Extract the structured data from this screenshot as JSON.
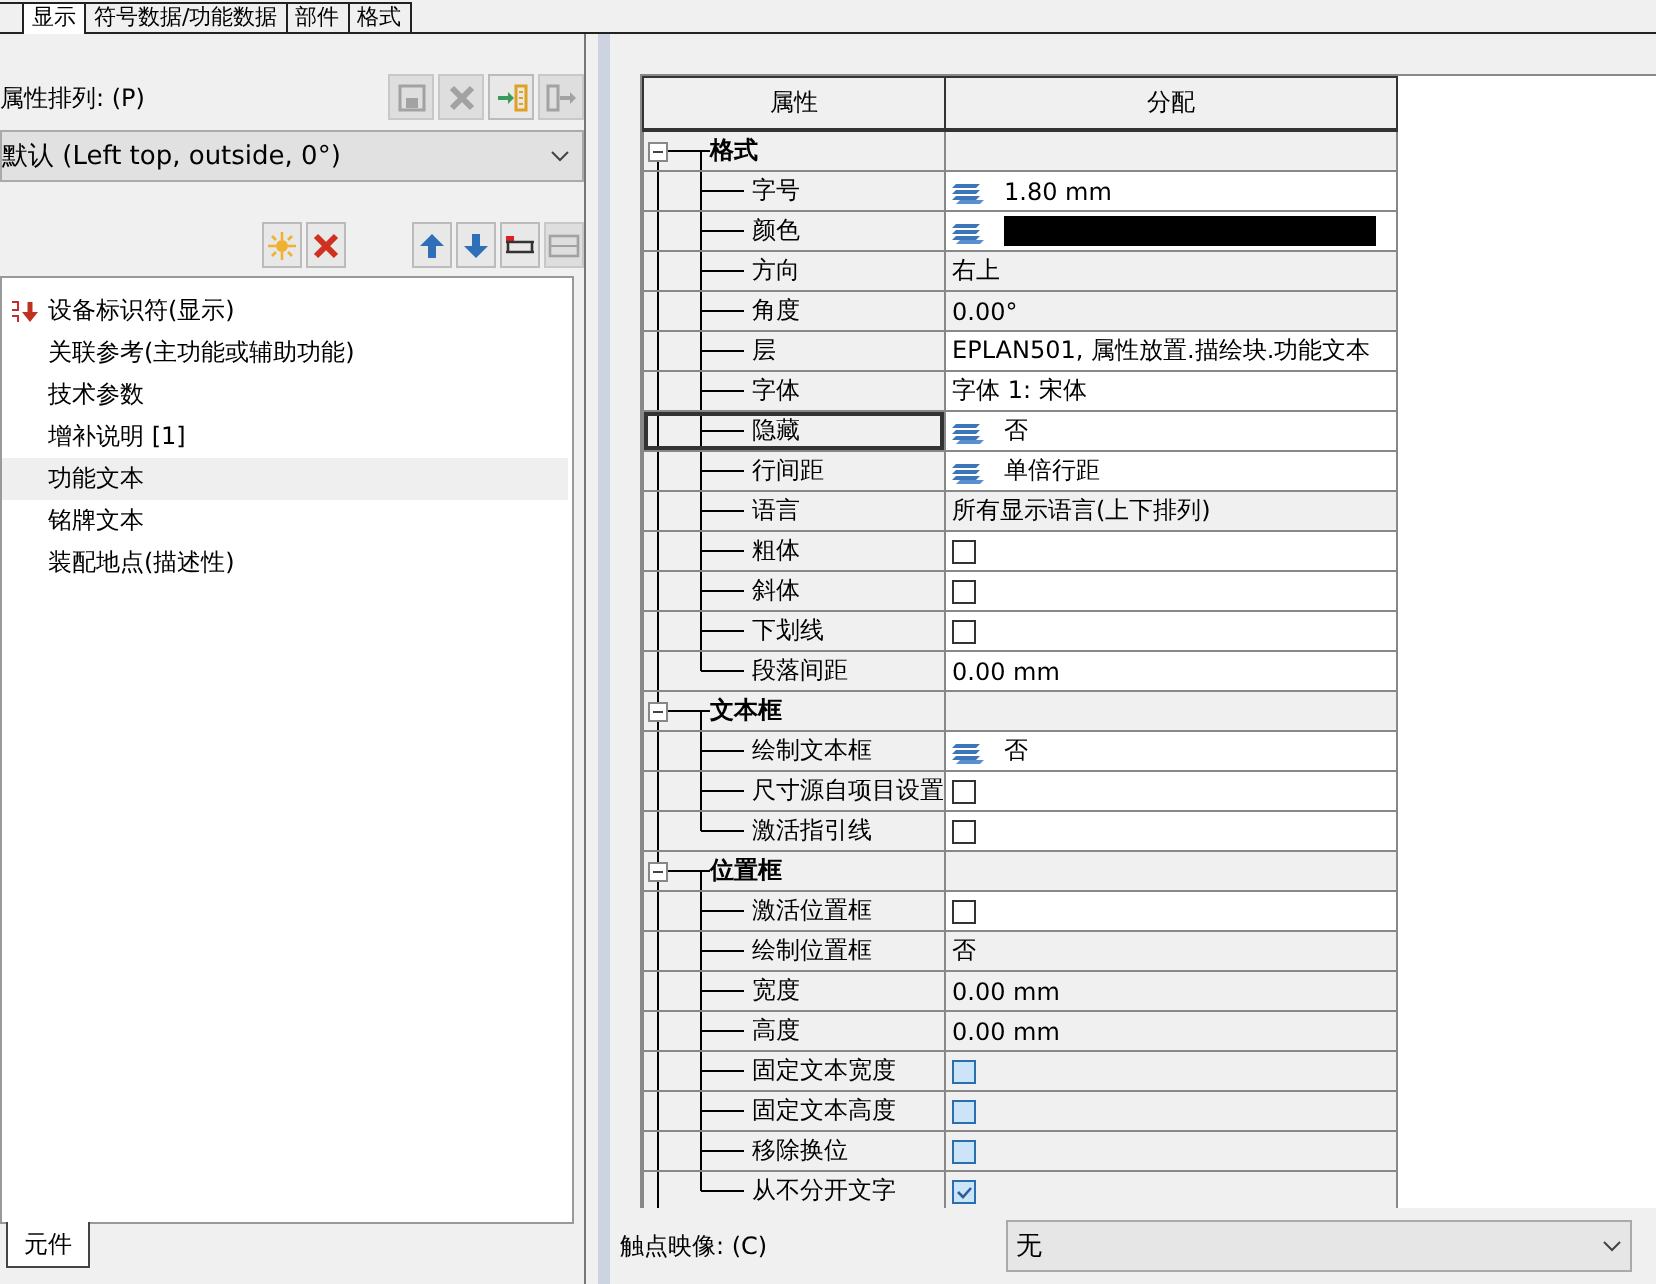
{
  "tabs": [
    {
      "label": "显示",
      "selected": true
    },
    {
      "label": "符号数据/功能数据",
      "selected": false
    },
    {
      "label": "部件",
      "selected": false
    },
    {
      "label": "格式",
      "selected": false
    }
  ],
  "arrangement": {
    "label": "属性排列: (P)",
    "value": "默认 (Left top, outside, 0°)",
    "tools": [
      {
        "kind": "save",
        "disabled": true
      },
      {
        "kind": "delete",
        "disabled": true
      },
      {
        "kind": "import",
        "disabled": false
      },
      {
        "kind": "export",
        "disabled": true
      }
    ]
  },
  "list_tools": [
    {
      "kind": "new",
      "disabled": false
    },
    {
      "kind": "remove",
      "disabled": false
    },
    {
      "kind": "up",
      "disabled": false
    },
    {
      "kind": "down",
      "disabled": false
    },
    {
      "kind": "insert",
      "disabled": false
    },
    {
      "kind": "row",
      "disabled": true
    }
  ],
  "properties": [
    {
      "label": "设备标识符(显示)",
      "selected": false,
      "sorted": true
    },
    {
      "label": "关联参考(主功能或辅助功能)",
      "selected": false,
      "sorted": false
    },
    {
      "label": "技术参数",
      "selected": false,
      "sorted": false
    },
    {
      "label": "增补说明 [1]",
      "selected": false,
      "sorted": false
    },
    {
      "label": "功能文本",
      "selected": true,
      "sorted": false
    },
    {
      "label": "铭牌文本",
      "selected": false,
      "sorted": false
    },
    {
      "label": "装配地点(描述性)",
      "selected": false,
      "sorted": false
    }
  ],
  "bottom_tab": {
    "label": "元件",
    "selected": true
  },
  "grid": {
    "columns": [
      "属性",
      "分配"
    ],
    "groups": [
      {
        "label": "格式",
        "expanded": true,
        "rows": [
          {
            "label": "字号",
            "kind": "layered",
            "value": "1.80 mm",
            "editable": true,
            "focused": false
          },
          {
            "label": "颜色",
            "kind": "color",
            "color": "#000000",
            "editable": true,
            "focused": false
          },
          {
            "label": "方向",
            "kind": "text",
            "value": "右上",
            "editable": false,
            "focused": false
          },
          {
            "label": "角度",
            "kind": "text",
            "value": "0.00°",
            "editable": false,
            "focused": false
          },
          {
            "label": "层",
            "kind": "text",
            "value": "EPLAN501, 属性放置.描绘块.功能文本",
            "editable": true,
            "focused": false
          },
          {
            "label": "字体",
            "kind": "text",
            "value": "字体 1: 宋体",
            "editable": true,
            "focused": false
          },
          {
            "label": "隐藏",
            "kind": "layered",
            "value": "否",
            "editable": true,
            "focused": true
          },
          {
            "label": "行间距",
            "kind": "layered",
            "value": "单倍行距",
            "editable": true,
            "focused": false
          },
          {
            "label": "语言",
            "kind": "text",
            "value": "所有显示语言(上下排列)",
            "editable": false,
            "focused": false
          },
          {
            "label": "粗体",
            "kind": "checkbox",
            "checked": false,
            "editable": true,
            "focused": false
          },
          {
            "label": "斜体",
            "kind": "checkbox",
            "checked": false,
            "editable": true,
            "focused": false
          },
          {
            "label": "下划线",
            "kind": "checkbox",
            "checked": false,
            "editable": true,
            "focused": false
          },
          {
            "label": "段落间距",
            "kind": "text",
            "value": "0.00 mm",
            "editable": true,
            "focused": false
          }
        ]
      },
      {
        "label": "文本框",
        "expanded": true,
        "rows": [
          {
            "label": "绘制文本框",
            "kind": "layered",
            "value": "否",
            "editable": true,
            "focused": false
          },
          {
            "label": "尺寸源自项目设置",
            "kind": "checkbox",
            "checked": false,
            "editable": true,
            "focused": false
          },
          {
            "label": "激活指引线",
            "kind": "checkbox",
            "checked": false,
            "editable": true,
            "focused": false
          }
        ]
      },
      {
        "label": "位置框",
        "expanded": true,
        "rows": [
          {
            "label": "激活位置框",
            "kind": "checkbox",
            "checked": false,
            "editable": true,
            "focused": false
          },
          {
            "label": "绘制位置框",
            "kind": "text",
            "value": "否",
            "editable": false,
            "focused": false
          },
          {
            "label": "宽度",
            "kind": "text",
            "value": "0.00 mm",
            "editable": false,
            "focused": false
          },
          {
            "label": "高度",
            "kind": "text",
            "value": "0.00 mm",
            "editable": false,
            "focused": false
          },
          {
            "label": "固定文本宽度",
            "kind": "checkbox",
            "checked": false,
            "editable": false,
            "focused": false
          },
          {
            "label": "固定文本高度",
            "kind": "checkbox",
            "checked": false,
            "editable": false,
            "focused": false
          },
          {
            "label": "移除换位",
            "kind": "checkbox",
            "checked": false,
            "editable": false,
            "focused": false
          },
          {
            "label": "从不分开文字",
            "kind": "checkbox",
            "checked": true,
            "editable": false,
            "focused": false
          }
        ]
      }
    ]
  },
  "contact_image": {
    "label": "触点映像: (C)",
    "value": "无"
  }
}
